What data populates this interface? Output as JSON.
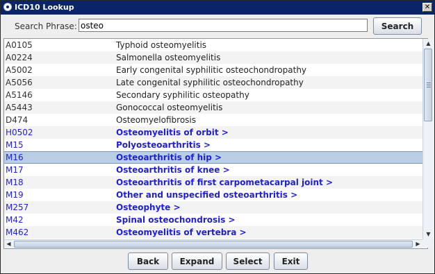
{
  "window": {
    "title": "ICD10 Lookup"
  },
  "search": {
    "label": "Search Phrase:",
    "value": "osteo",
    "button": "Search"
  },
  "rows": [
    {
      "code": "A0105",
      "desc": "Typhoid osteomyelitis",
      "type": "leaf"
    },
    {
      "code": "A0224",
      "desc": "Salmonella osteomyelitis",
      "type": "leaf"
    },
    {
      "code": "A5002",
      "desc": "Early congenital syphilitic osteochondropathy",
      "type": "leaf"
    },
    {
      "code": "A5056",
      "desc": "Late congenital syphilitic osteochondropathy",
      "type": "leaf"
    },
    {
      "code": "A5146",
      "desc": "Secondary syphilitic osteopathy",
      "type": "leaf"
    },
    {
      "code": "A5443",
      "desc": "Gonococcal osteomyelitis",
      "type": "leaf"
    },
    {
      "code": "D474",
      "desc": "Osteomyelofibrosis",
      "type": "leaf"
    },
    {
      "code": "H0502",
      "desc": "Osteomyelitis of orbit  >",
      "type": "branch"
    },
    {
      "code": "M15",
      "desc": "Polyosteoarthritis  >",
      "type": "branch"
    },
    {
      "code": "M16",
      "desc": "Osteoarthritis of hip  >",
      "type": "branch",
      "selected": true
    },
    {
      "code": "M17",
      "desc": "Osteoarthritis of knee  >",
      "type": "branch"
    },
    {
      "code": "M18",
      "desc": "Osteoarthritis of first carpometacarpal joint  >",
      "type": "branch"
    },
    {
      "code": "M19",
      "desc": "Other and unspecified osteoarthritis  >",
      "type": "branch"
    },
    {
      "code": "M257",
      "desc": "Osteophyte  >",
      "type": "branch"
    },
    {
      "code": "M42",
      "desc": "Spinal osteochondrosis  >",
      "type": "branch"
    },
    {
      "code": "M462",
      "desc": "Osteomyelitis of vertebra  >",
      "type": "branch"
    }
  ],
  "footer": {
    "back": "Back",
    "expand": "Expand",
    "select": "Select",
    "exit": "Exit"
  },
  "colors": {
    "titlebar": "#0a246a",
    "selection": "#b8cfe5",
    "branch_text": "#1f1fd6"
  }
}
